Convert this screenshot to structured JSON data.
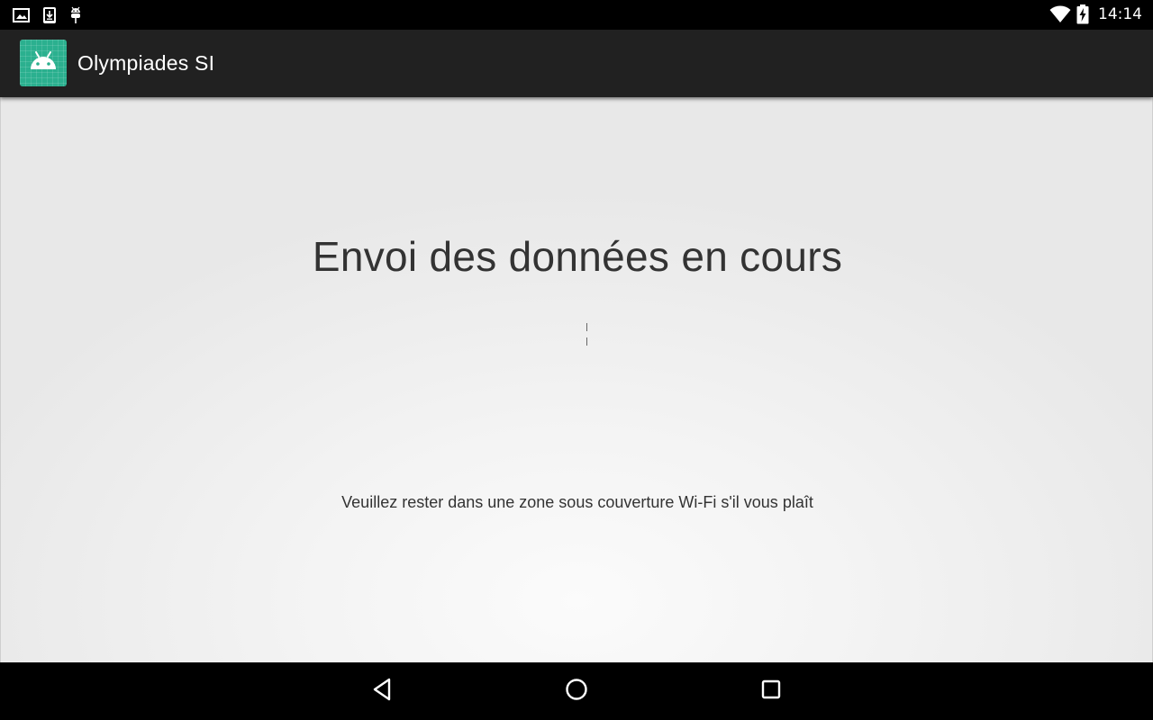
{
  "status_bar": {
    "icons_left": [
      "image-notification-icon",
      "download-notification-icon",
      "android-debug-icon"
    ],
    "icons_right": [
      "wifi-icon",
      "battery-charging-icon"
    ],
    "time": "14:14"
  },
  "app_bar": {
    "title": "Olympiades SI",
    "logo_icon": "android-icon",
    "logo_color": "#2bb08f",
    "background": "#212121"
  },
  "main": {
    "title": "Envoi des données en cours",
    "message": "Veuillez rester dans une zone sous couverture Wi-Fi s'il vous plaît"
  },
  "nav_bar": {
    "buttons": [
      "back-icon",
      "home-icon",
      "recents-icon"
    ]
  }
}
